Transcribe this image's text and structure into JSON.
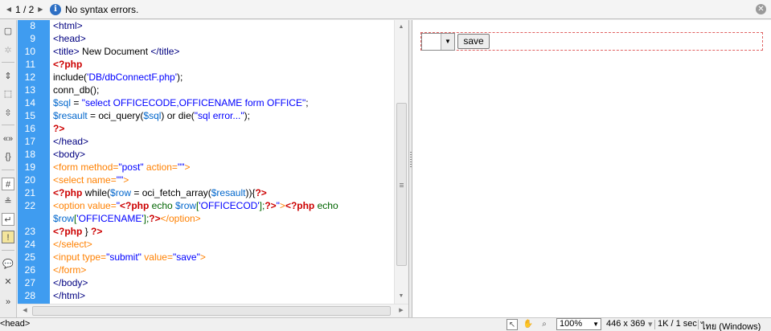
{
  "topbar": {
    "pager": "1 / 2",
    "message": "No syntax errors."
  },
  "code": {
    "lines": [
      {
        "n": "8",
        "parts": [
          {
            "c": "c-tag",
            "t": "<html>"
          }
        ]
      },
      {
        "n": "9",
        "parts": [
          {
            "c": "c-tag",
            "t": "<head>"
          }
        ]
      },
      {
        "n": "10",
        "parts": [
          {
            "c": "c-tag",
            "t": "<title>"
          },
          {
            "c": "c-text",
            "t": " New Document "
          },
          {
            "c": "c-tag",
            "t": "</title>"
          }
        ]
      },
      {
        "n": "11",
        "parts": [
          {
            "c": "c-php",
            "t": "<?php"
          }
        ]
      },
      {
        "n": "12",
        "parts": [
          {
            "c": "c-fn",
            "t": "include("
          },
          {
            "c": "c-str",
            "t": "'DB/dbConnectF.php'"
          },
          {
            "c": "c-fn",
            "t": ");"
          }
        ]
      },
      {
        "n": "13",
        "parts": [
          {
            "c": "c-fn",
            "t": "conn_db();"
          }
        ]
      },
      {
        "n": "14",
        "parts": [
          {
            "c": "c-var",
            "t": "$sql"
          },
          {
            "c": "c-fn",
            "t": " = "
          },
          {
            "c": "c-str",
            "t": "\"select OFFICECODE,OFFICENAME form OFFICE\""
          },
          {
            "c": "c-fn",
            "t": ";"
          }
        ]
      },
      {
        "n": "15",
        "parts": [
          {
            "c": "c-var",
            "t": "$resault"
          },
          {
            "c": "c-fn",
            "t": " = oci_query("
          },
          {
            "c": "c-var",
            "t": "$sql"
          },
          {
            "c": "c-fn",
            "t": ") or die("
          },
          {
            "c": "c-str",
            "t": "\"sql error...\""
          },
          {
            "c": "c-fn",
            "t": ");"
          }
        ]
      },
      {
        "n": "16",
        "parts": [
          {
            "c": "c-php",
            "t": "?>"
          }
        ]
      },
      {
        "n": "17",
        "parts": [
          {
            "c": "c-tag",
            "t": "</head>"
          }
        ]
      },
      {
        "n": "18",
        "parts": [
          {
            "c": "c-tag",
            "t": "<body>"
          }
        ]
      },
      {
        "n": "19",
        "parts": [
          {
            "c": "c-form",
            "t": "<form method="
          },
          {
            "c": "c-str",
            "t": "\"post\""
          },
          {
            "c": "c-form",
            "t": " action="
          },
          {
            "c": "c-str",
            "t": "\"\""
          },
          {
            "c": "c-form",
            "t": ">"
          }
        ]
      },
      {
        "n": "20",
        "parts": [
          {
            "c": "c-form",
            "t": "<select name="
          },
          {
            "c": "c-str",
            "t": "\"\""
          },
          {
            "c": "c-form",
            "t": ">"
          }
        ]
      },
      {
        "n": "21",
        "parts": [
          {
            "c": "c-php",
            "t": "<?php"
          },
          {
            "c": "c-fn",
            "t": " while("
          },
          {
            "c": "c-var",
            "t": "$row"
          },
          {
            "c": "c-fn",
            "t": " = oci_fetch_array("
          },
          {
            "c": "c-var",
            "t": "$resault"
          },
          {
            "c": "c-fn",
            "t": ")){"
          },
          {
            "c": "c-php",
            "t": "?>"
          }
        ]
      },
      {
        "n": "22",
        "parts": [
          {
            "c": "c-form",
            "t": "<option value="
          },
          {
            "c": "c-str",
            "t": "\""
          },
          {
            "c": "c-php",
            "t": "<?php"
          },
          {
            "c": "c-echo",
            "t": " echo "
          },
          {
            "c": "c-var",
            "t": "$row"
          },
          {
            "c": "c-echo",
            "t": "["
          },
          {
            "c": "c-str",
            "t": "'OFFICECOD'"
          },
          {
            "c": "c-echo",
            "t": "];"
          },
          {
            "c": "c-php",
            "t": "?>"
          },
          {
            "c": "c-str",
            "t": "\""
          },
          {
            "c": "c-form",
            "t": ">"
          },
          {
            "c": "c-php",
            "t": "<?php"
          },
          {
            "c": "c-echo",
            "t": " echo"
          }
        ]
      },
      {
        "n": "",
        "parts": [
          {
            "c": "c-var",
            "t": "$row"
          },
          {
            "c": "c-echo",
            "t": "["
          },
          {
            "c": "c-str",
            "t": "'OFFICENAME'"
          },
          {
            "c": "c-echo",
            "t": "];"
          },
          {
            "c": "c-php",
            "t": "?>"
          },
          {
            "c": "c-form",
            "t": "</option>"
          }
        ]
      },
      {
        "n": "23",
        "parts": [
          {
            "c": "c-php",
            "t": "<?php"
          },
          {
            "c": "c-fn",
            "t": " } "
          },
          {
            "c": "c-php",
            "t": "?>"
          }
        ]
      },
      {
        "n": "24",
        "parts": [
          {
            "c": "c-form",
            "t": "</select>"
          }
        ]
      },
      {
        "n": "25",
        "parts": [
          {
            "c": "c-form",
            "t": "<input type="
          },
          {
            "c": "c-str",
            "t": "\"submit\""
          },
          {
            "c": "c-form",
            "t": " value="
          },
          {
            "c": "c-str",
            "t": "\"save\""
          },
          {
            "c": "c-form",
            "t": ">"
          }
        ]
      },
      {
        "n": "26",
        "parts": [
          {
            "c": "c-form",
            "t": "</form>"
          }
        ]
      },
      {
        "n": "27",
        "parts": [
          {
            "c": "c-tag",
            "t": "</body>"
          }
        ]
      },
      {
        "n": "28",
        "parts": [
          {
            "c": "c-tag",
            "t": "</html>"
          }
        ]
      }
    ]
  },
  "design": {
    "save_label": "save"
  },
  "status": {
    "tag_selector": "<head>",
    "zoom": "100%",
    "dimensions": "446 x 369",
    "download": "1K / 1 sec",
    "encoding": "ไทย (Windows)"
  }
}
